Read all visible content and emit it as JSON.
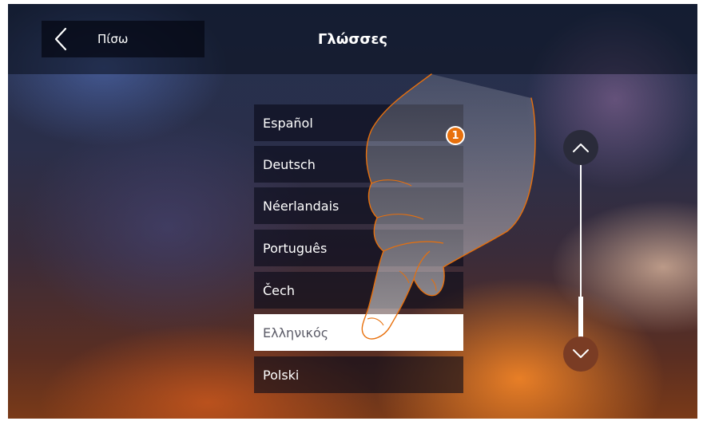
{
  "header": {
    "back_label": "Πίσω",
    "title": "Γλώσσες"
  },
  "languages": {
    "items": [
      {
        "label": "Español"
      },
      {
        "label": "Deutsch"
      },
      {
        "label": "Néerlandais"
      },
      {
        "label": "Português"
      },
      {
        "label": "Čech"
      },
      {
        "label": "Ελληνικός",
        "selected": true
      },
      {
        "label": "Polski"
      }
    ]
  },
  "callout": {
    "number": "1"
  },
  "icons": {
    "back": "chevron-left-icon",
    "scroll_up": "chevron-up-icon",
    "scroll_down": "chevron-down-icon"
  },
  "colors": {
    "selected_bg": "#ffffff",
    "badge": "#e8700c",
    "hand_outline": "#e8700c"
  }
}
